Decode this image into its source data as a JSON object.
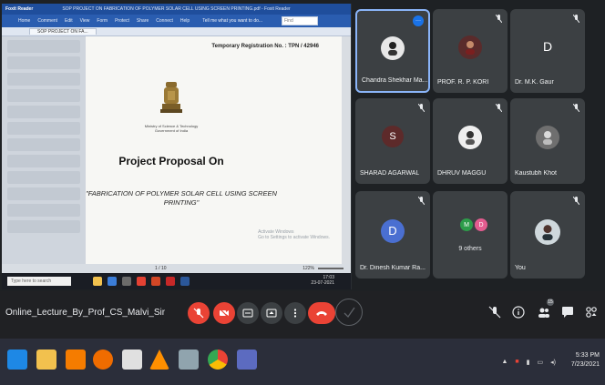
{
  "reader": {
    "app_name": "Foxit Reader",
    "window_title": "SOP PROJECT ON FABRICATION OF POLYMER SOLAR CELL USING SCREEN PRINTING.pdf - Foxit Reader",
    "menu": [
      "Home",
      "Comment",
      "Edit",
      "View",
      "Form",
      "Protect",
      "Share",
      "Connect",
      "Help"
    ],
    "tell_me": "Tell me what you want to do...",
    "search_placeholder": "Find",
    "doc_tab": "SOP PROJECT ON FA...",
    "page_counter": "1 / 10",
    "zoom": "122%"
  },
  "document": {
    "registration": "Temporary Registration No. : TPN / 42946",
    "ministry_lines": [
      "Ministry of Science & Technology",
      "Government of India"
    ],
    "title": "Project Proposal On",
    "project_name": "\"FABRICATION OF POLYMER SOLAR CELL USING SCREEN PRINTING\"",
    "watermark": "Activate Windows\nGo to Settings to activate Windows."
  },
  "inner_taskbar": {
    "search": "Type here to search",
    "clock_time": "17:03",
    "clock_date": "23-07-2021"
  },
  "participants": [
    {
      "name": "Chandra Shekhar Ma...",
      "type": "photo",
      "speaking": true
    },
    {
      "name": "PROF. R. P. KORI",
      "type": "photo",
      "muted": true
    },
    {
      "name": "Dr. M.K. Gaur",
      "initial": "D",
      "color": "#3c4043",
      "muted": true
    },
    {
      "name": "SHARAD AGARWAL",
      "initial": "S",
      "color": "#5d2a2a",
      "muted": true
    },
    {
      "name": "DHRUV MAGGU",
      "type": "photo",
      "muted": true
    },
    {
      "name": "Kaustubh Khot",
      "type": "photo",
      "muted": true
    },
    {
      "name": "Dr. Dinesh Kumar Ra...",
      "initial": "D",
      "color": "#4a6fd1",
      "muted": true
    },
    {
      "name": "9 others",
      "group": [
        "M",
        "D"
      ],
      "group_colors": [
        "#2d9c4a",
        "#e35c8f"
      ]
    },
    {
      "name": "You",
      "type": "photo",
      "muted": true
    }
  ],
  "meet": {
    "meeting_name": "Online_Lecture_By_Prof_CS_Malvi_Sir",
    "participant_count": "15"
  },
  "taskbar": {
    "time": "5:33 PM",
    "date": "7/23/2021"
  },
  "colors": {
    "meet_bg": "#202124",
    "tile_bg": "#3c4043",
    "red": "#ea4335",
    "accent": "#1a73e8",
    "reader_blue": "#2a5db0"
  }
}
